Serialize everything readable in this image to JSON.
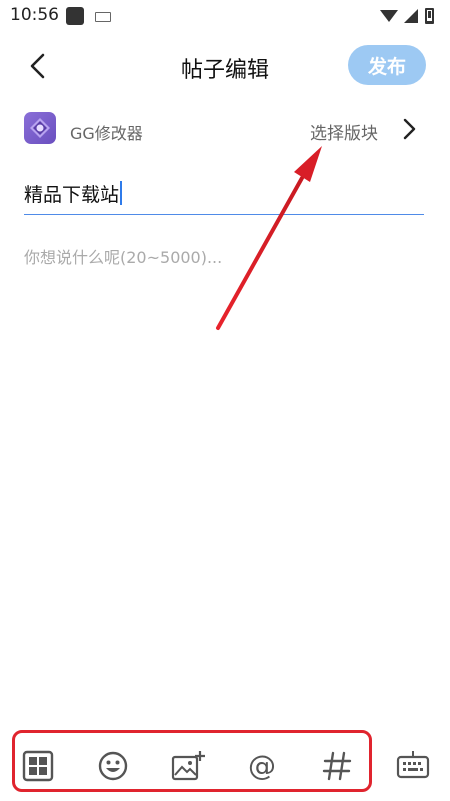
{
  "status_bar": {
    "time": "10:56"
  },
  "header": {
    "title": "帖子编辑",
    "publish_label": "发布"
  },
  "board": {
    "app_name": "GG修改器",
    "select_label": "选择版块"
  },
  "editor": {
    "title_value": "精品下载站",
    "body_placeholder": "你想说什么呢(20~5000)..."
  },
  "toolbar": {
    "items": [
      "grid-icon",
      "emoji-icon",
      "image-add-icon",
      "mention-icon",
      "hashtag-icon",
      "keyboard-icon"
    ]
  },
  "colors": {
    "accent": "#4f8be8",
    "publish_bg": "#9dc9f3",
    "annotation": "#e0242e"
  }
}
